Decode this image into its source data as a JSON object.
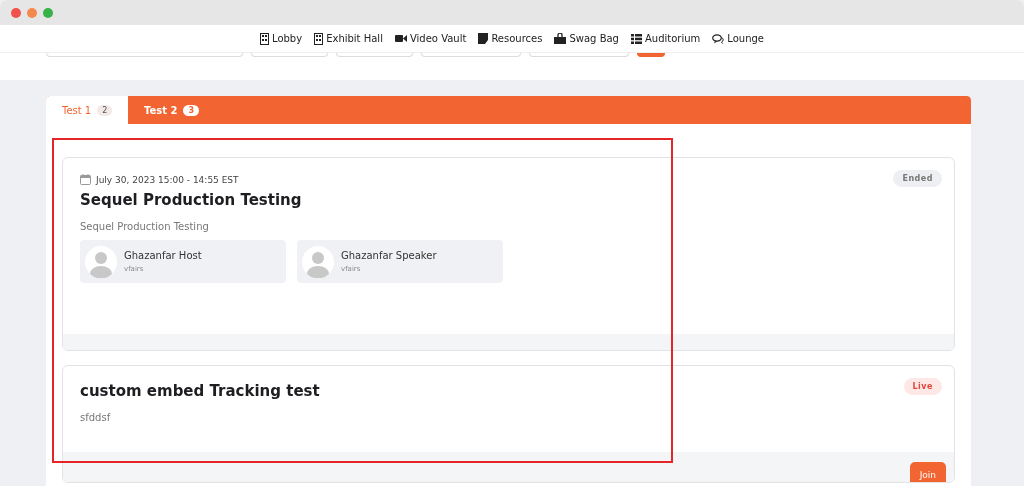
{
  "nav": [
    {
      "label": "Lobby",
      "kind": "building"
    },
    {
      "label": "Exhibit Hall",
      "kind": "building"
    },
    {
      "label": "Video Vault",
      "kind": "video"
    },
    {
      "label": "Resources",
      "kind": "note"
    },
    {
      "label": "Swag Bag",
      "kind": "bag"
    },
    {
      "label": "Auditorium",
      "kind": "list"
    },
    {
      "label": "Lounge",
      "kind": "chat"
    }
  ],
  "tabs": [
    {
      "label": "Test 1",
      "count": "2",
      "selected": true
    },
    {
      "label": "Test 2",
      "count": "3",
      "selected": false
    }
  ],
  "sessions": [
    {
      "date": "July 30, 2023 15:00 - 14:55 EST",
      "title": "Sequel Production Testing",
      "description": "Sequel Production Testing",
      "status": "Ended",
      "kind": "ended",
      "speakers": [
        {
          "name": "Ghazanfar Host",
          "org": "vfairs"
        },
        {
          "name": "Ghazanfar Speaker",
          "org": "vfairs"
        }
      ]
    },
    {
      "title": "custom embed Tracking test",
      "description": "sfddsf",
      "status": "Live",
      "kind": "live",
      "action": "Join"
    }
  ]
}
